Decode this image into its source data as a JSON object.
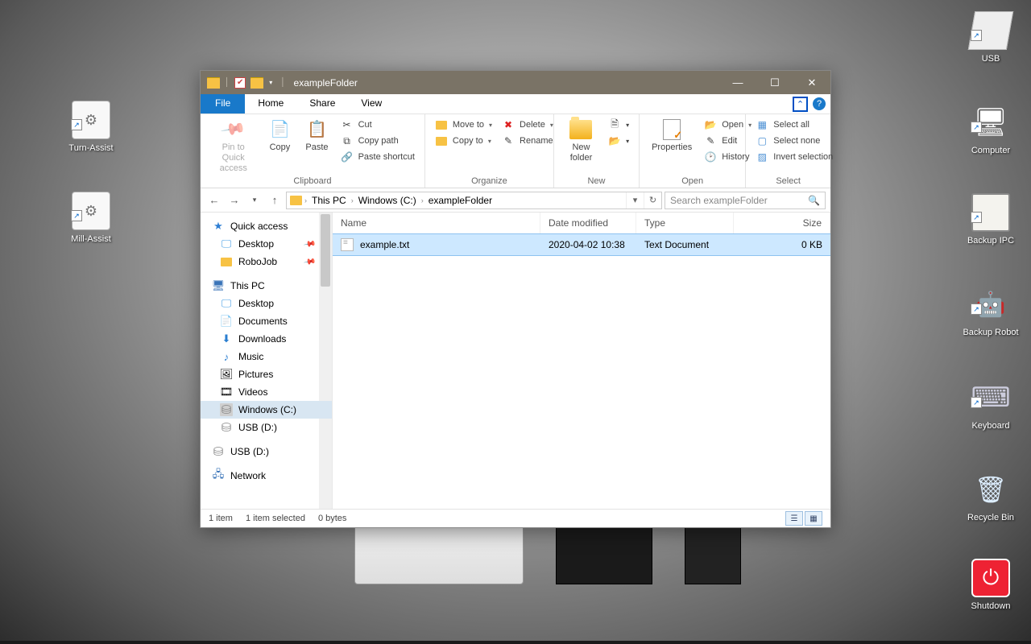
{
  "desktop_icons": {
    "left": [
      {
        "label": "Turn-Assist"
      },
      {
        "label": "Mill-Assist"
      }
    ],
    "right": [
      {
        "label": "USB"
      },
      {
        "label": "Computer"
      },
      {
        "label": "Backup IPC"
      },
      {
        "label": "Backup Robot"
      },
      {
        "label": "Keyboard"
      },
      {
        "label": "Recycle Bin"
      },
      {
        "label": "Shutdown"
      }
    ]
  },
  "window": {
    "title": "exampleFolder",
    "tabs": {
      "file": "File",
      "home": "Home",
      "share": "Share",
      "view": "View"
    },
    "ribbon": {
      "clipboard": {
        "label": "Clipboard",
        "pin": "Pin to Quick access",
        "copy": "Copy",
        "paste": "Paste",
        "cut": "Cut",
        "copypath": "Copy path",
        "pasteshortcut": "Paste shortcut"
      },
      "organize": {
        "label": "Organize",
        "moveto": "Move to",
        "copyto": "Copy to",
        "delete": "Delete",
        "rename": "Rename"
      },
      "new": {
        "label": "New",
        "newfolder": "New folder"
      },
      "open": {
        "label": "Open",
        "properties": "Properties",
        "open": "Open",
        "edit": "Edit",
        "history": "History"
      },
      "select": {
        "label": "Select",
        "all": "Select all",
        "none": "Select none",
        "invert": "Invert selection"
      }
    },
    "breadcrumbs": [
      "This PC",
      "Windows (C:)",
      "exampleFolder"
    ],
    "search_placeholder": "Search exampleFolder",
    "nav": {
      "quick": "Quick access",
      "desktop": "Desktop",
      "robojob": "RoboJob",
      "thispc": "This PC",
      "pc_desktop": "Desktop",
      "documents": "Documents",
      "downloads": "Downloads",
      "music": "Music",
      "pictures": "Pictures",
      "videos": "Videos",
      "winc": "Windows (C:)",
      "usbd1": "USB (D:)",
      "usbd2": "USB (D:)",
      "network": "Network"
    },
    "columns": {
      "name": "Name",
      "date": "Date modified",
      "type": "Type",
      "size": "Size"
    },
    "files": [
      {
        "name": "example.txt",
        "date": "2020-04-02 10:38",
        "type": "Text Document",
        "size": "0 KB"
      }
    ],
    "status": {
      "count": "1 item",
      "selected": "1 item selected",
      "bytes": "0 bytes"
    }
  }
}
